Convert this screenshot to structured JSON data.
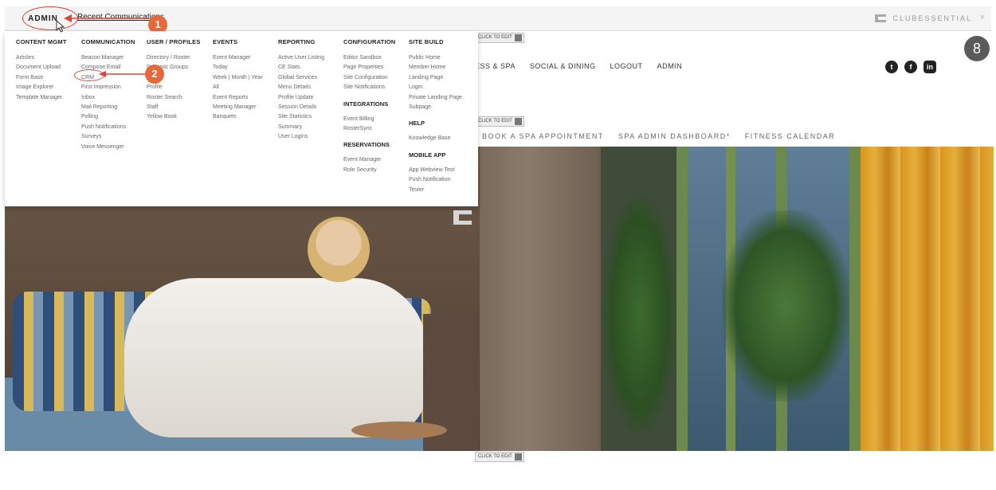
{
  "admin_bar": {
    "admin_label": "ADMIN",
    "recent_label": "Recent Communications",
    "brand_label": "CLUBESSENTIAL",
    "close_label": "×"
  },
  "callouts": [
    "1",
    "2"
  ],
  "site_nav": [
    "ESS & SPA",
    "SOCIAL & DINING",
    "LOGOUT",
    "ADMIN"
  ],
  "sub_nav": [
    "BOOK A SPA APPOINTMENT",
    "SPA ADMIN DASHBOARD*",
    "FITNESS CALENDAR"
  ],
  "edit_badge_label": "CLICK TO EDIT",
  "social_icons": [
    "twitter-icon",
    "facebook-icon",
    "linkedin-icon"
  ],
  "social_glyphs": [
    "t",
    "f",
    "in"
  ],
  "user_icon": "8",
  "mega_menu": {
    "content": {
      "heading": "CONTENT MGMT",
      "items": [
        "Articles",
        "Document Upload",
        "Form Base",
        "Image Explorer",
        "Template Manager"
      ]
    },
    "communication": {
      "heading": "COMMUNICATION",
      "items": [
        "Beacon Manager",
        "Compose Email",
        "CRM",
        "First Impression",
        "Inbox",
        "Mail Reporting",
        "Polling",
        "Push Notifications",
        "Surveys",
        "Voice Messenger"
      ]
    },
    "user_profiles": {
      "heading": "USER / PROFILES",
      "items": [
        "Directory / Roster",
        "Dynamic Groups",
        "",
        "Profile",
        "Roster Search",
        "Staff",
        "Yellow Book"
      ]
    },
    "events": {
      "heading": "EVENTS",
      "items": [
        "Event Manager",
        "Today",
        "Week | Month | Year",
        "All",
        "Event Reports",
        "Meeting Manager",
        "Banquets"
      ]
    },
    "reporting": {
      "heading": "REPORTING",
      "items": [
        "Active User Listing",
        "CE Stats",
        "Global Services",
        "Menu Details",
        "Profile Update",
        "Session Details",
        "Site Statistics",
        "Summary",
        "User Logins"
      ]
    },
    "configuration": {
      "heading": "CONFIGURATION",
      "items": [
        "Editor Sandbox",
        "Page Properties",
        "Site Configuration",
        "Site Notifications"
      ]
    },
    "integrations": {
      "heading": "INTEGRATIONS",
      "items": [
        "Event Billing",
        "RosterSync"
      ]
    },
    "reservations": {
      "heading": "RESERVATIONS",
      "items": [
        "Event Manager",
        "Role Security"
      ]
    },
    "site_build": {
      "heading": "SITE BUILD",
      "items": [
        "Public Home",
        "Member Home",
        "Landing Page",
        "Login",
        "Private Landing Page",
        "Subpage"
      ]
    },
    "help": {
      "heading": "HELP",
      "items": [
        "Knowledge Base"
      ]
    },
    "mobile_app": {
      "heading": "MOBILE APP",
      "items": [
        "App Webview Test",
        "Push Notification Tester"
      ]
    }
  },
  "colors": {
    "accent_red": "#d9463c",
    "callout_orange": "#e8683a"
  }
}
